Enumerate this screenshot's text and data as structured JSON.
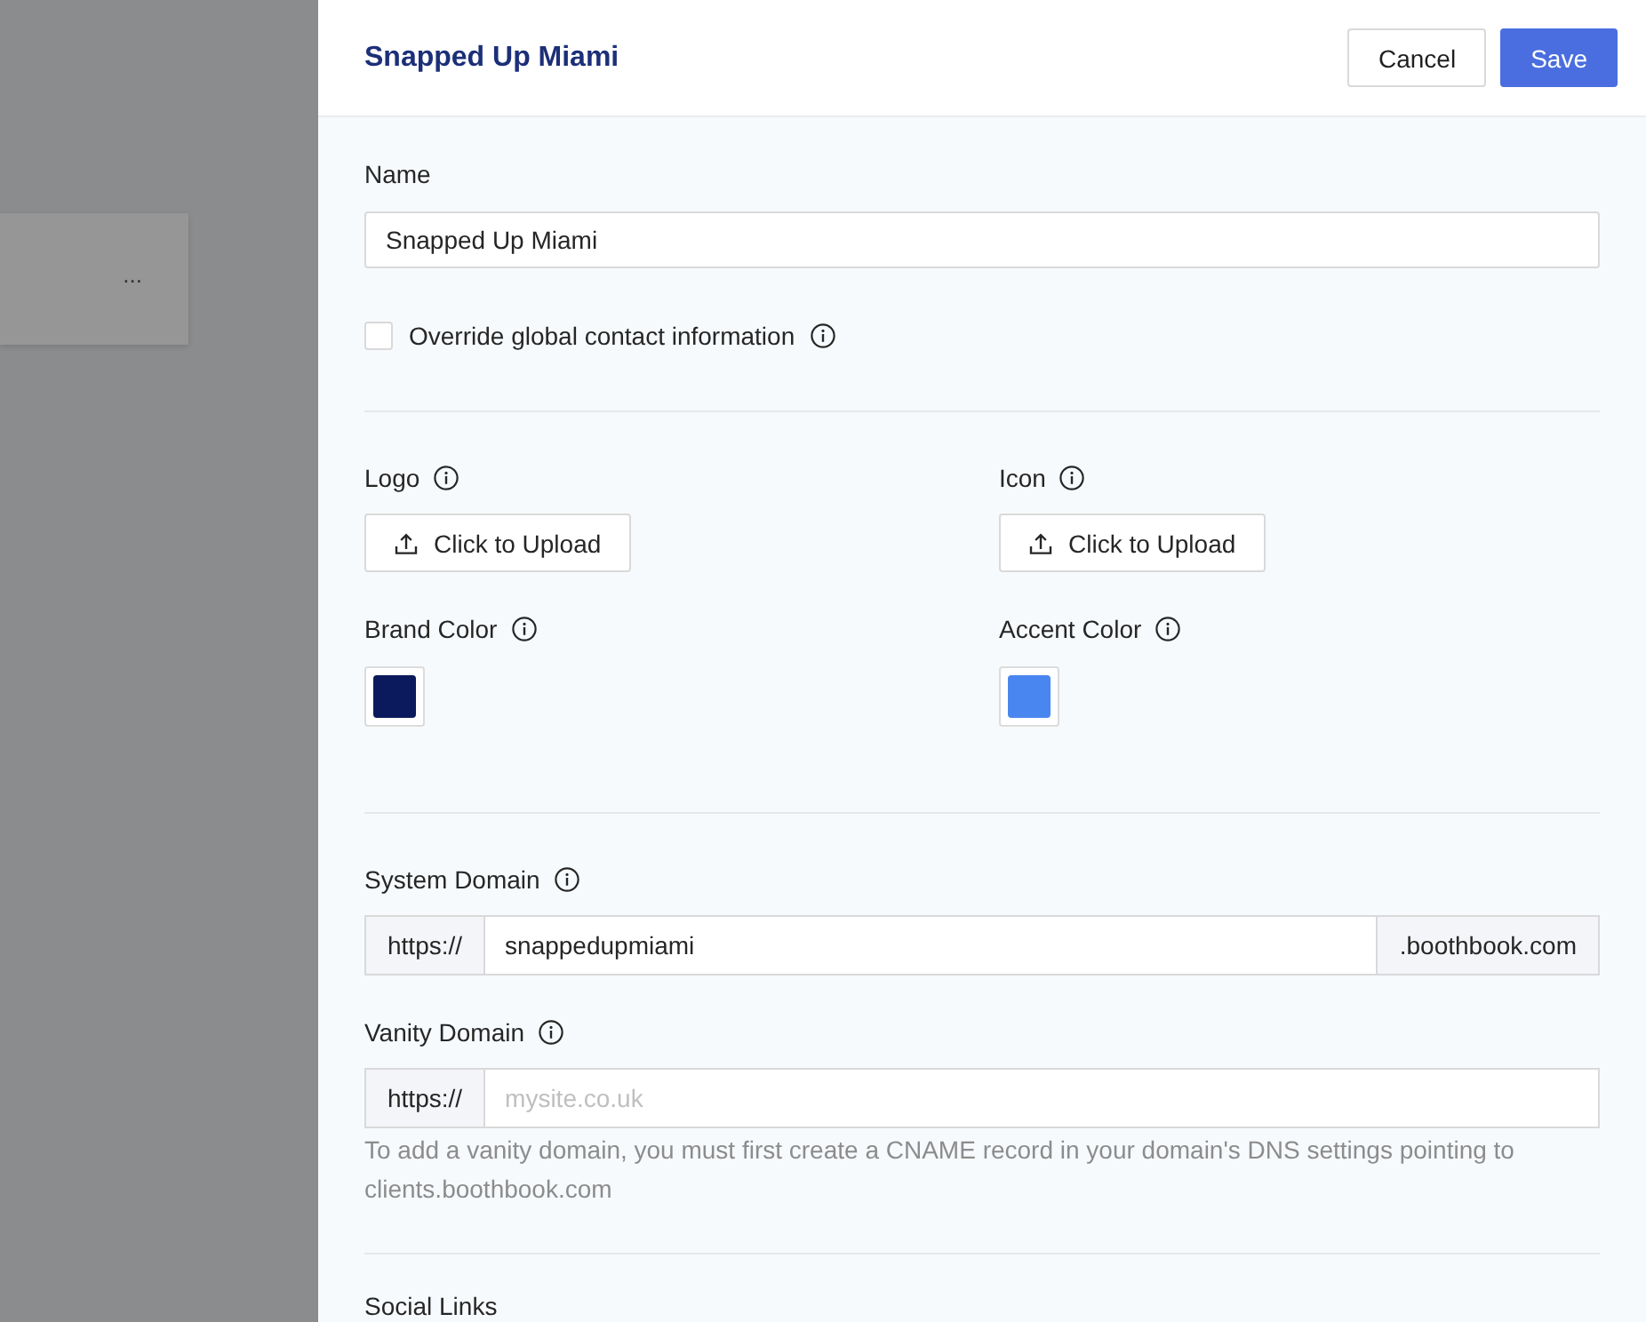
{
  "backdrop": {
    "card_menu": "..."
  },
  "drawer": {
    "title": "Snapped Up Miami",
    "actions": [
      {
        "label": "Cancel",
        "kind": "secondary"
      },
      {
        "label": "Save",
        "kind": "primary"
      }
    ]
  },
  "name_field": {
    "label": "Name",
    "info": false,
    "value": "Snapped Up Miami"
  },
  "override": {
    "label": "Override global contact information",
    "info": true,
    "checked": false
  },
  "uploads": [
    {
      "label": "Logo",
      "info": true,
      "button": "Click to Upload"
    },
    {
      "label": "Icon",
      "info": true,
      "button": "Click to Upload"
    }
  ],
  "colors": [
    {
      "label": "Brand Color",
      "info": true,
      "color": "#0b1a5c"
    },
    {
      "label": "Accent Color",
      "info": true,
      "color": "#4a86f0"
    }
  ],
  "domains": [
    {
      "label": "System Domain",
      "info": true,
      "prefix": "https://",
      "value": "snappedupmiami",
      "suffix": ".boothbook.com"
    },
    {
      "label": "Vanity Domain",
      "info": true,
      "prefix": "https://",
      "placeholder": "mysite.co.uk",
      "help": "To add a vanity domain, you must first create a CNAME record in your domain's DNS settings pointing to clients.boothbook.com"
    }
  ],
  "social_links": {
    "label": "Social Links"
  }
}
